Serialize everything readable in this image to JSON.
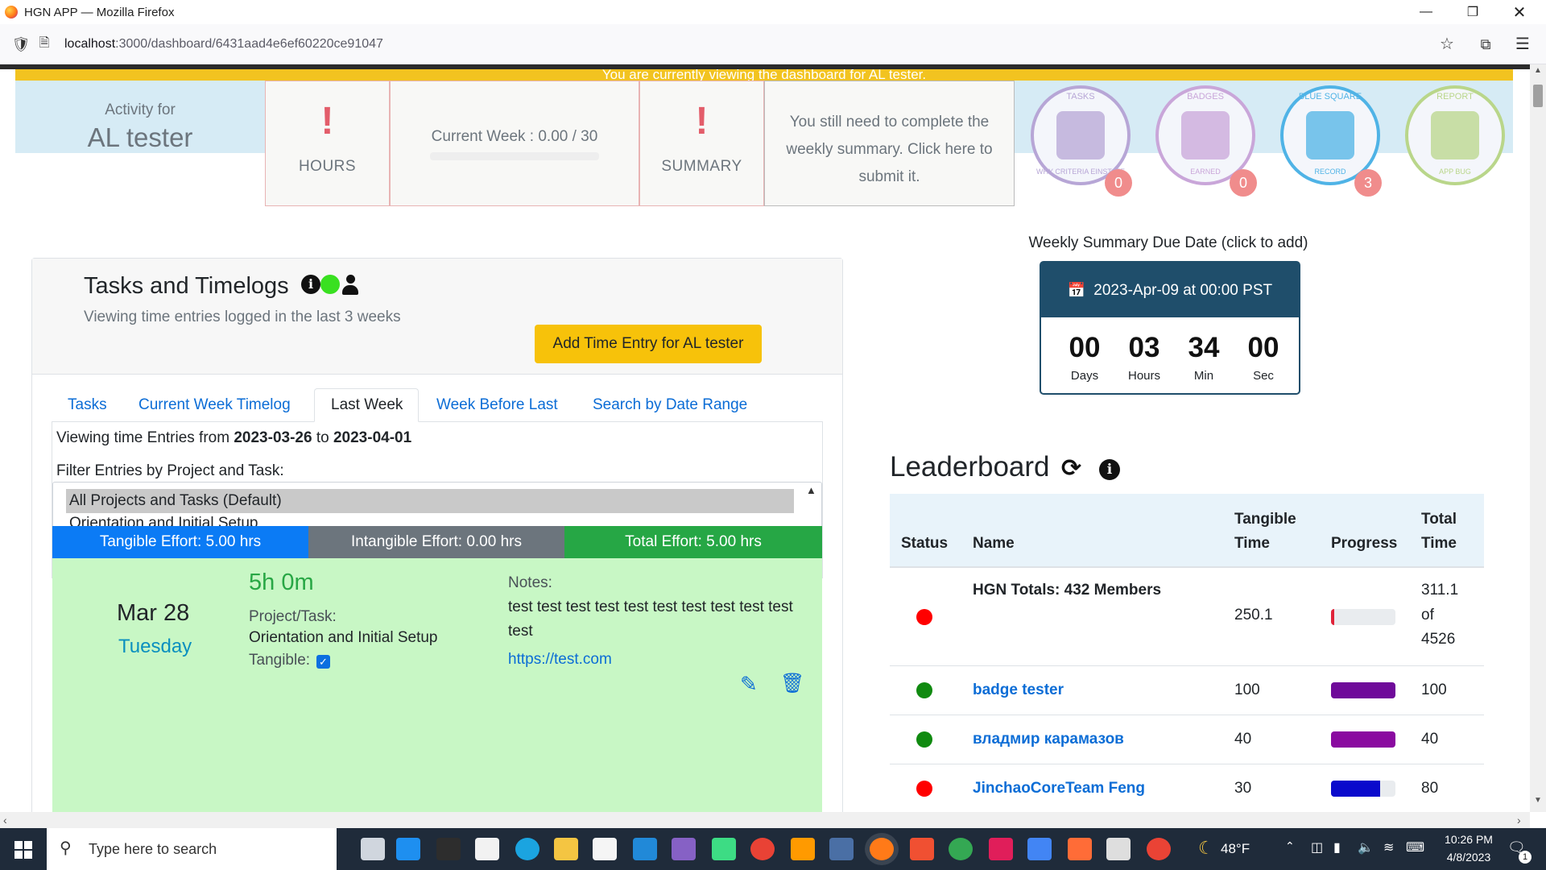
{
  "window": {
    "title": "HGN APP — Mozilla Firefox",
    "url_host": "localhost",
    "url_path": ":3000/dashboard/6431aad4e6ef60220ce91047"
  },
  "banner": {
    "notice": "You are currently viewing the dashboard for AL tester.",
    "activity_label": "Activity for",
    "activity_name": "AL tester",
    "hours_label": "HOURS",
    "current_week": "Current Week : 0.00 / 30",
    "summary_label": "SUMMARY",
    "summary_msg": "You still need to complete the weekly summary. Click here to submit it.",
    "badges": [
      {
        "name": "TASKS",
        "sub": "WHY CRITERIA EINSTATE",
        "count": "0",
        "color": "#b7a6d6"
      },
      {
        "name": "BADGES",
        "sub": "EARNED",
        "count": "0",
        "color": "#c9a6d9"
      },
      {
        "name": "BLUE SQUARE",
        "sub": "RECORD",
        "count": "3",
        "color": "#4fb3e6"
      },
      {
        "name": "REPORT",
        "sub": "APP BUG",
        "count": "",
        "color": "#b9d68a"
      }
    ]
  },
  "tasks": {
    "title": "Tasks and Timelogs",
    "subtitle": "Viewing time entries logged in the last 3 weeks",
    "add_button": "Add Time Entry for AL tester",
    "tabs": [
      "Tasks",
      "Current Week Timelog",
      "Last Week",
      "Week Before Last",
      "Search by Date Range"
    ],
    "viewing_prefix": "Viewing time Entries from",
    "date_from": "2023-03-26",
    "to_word": "to",
    "date_to": "2023-04-01",
    "filter_label": "Filter Entries by Project and Task:",
    "filter_options": [
      "All Projects and Tasks (Default)",
      "Orientation and Initial Setup"
    ],
    "tangible_effort": "Tangible Effort: 5.00 hrs",
    "intangible_effort": "Intangible Effort: 0.00 hrs",
    "total_effort": "Total Effort: 5.00 hrs",
    "entry": {
      "date": "Mar 28",
      "weekday": "Tuesday",
      "duration": "5h 0m",
      "project_label": "Project/Task:",
      "project": "Orientation and Initial Setup",
      "tangible_label": "Tangible:",
      "notes_label": "Notes:",
      "notes": "test test test test test test test test test test test",
      "link": "https://test.com"
    }
  },
  "due": {
    "label": "Weekly Summary Due Date (click to add)",
    "date": "2023-Apr-09 at 00:00 PST",
    "days": "00",
    "days_label": "Days",
    "hours": "03",
    "hours_label": "Hours",
    "min": "34",
    "min_label": "Min",
    "sec": "00",
    "sec_label": "Sec"
  },
  "leaderboard": {
    "title": "Leaderboard",
    "headers": {
      "status": "Status",
      "name": "Name",
      "tangible_1": "Tangible",
      "tangible_2": "Time",
      "progress": "Progress",
      "total_1": "Total",
      "total_2": "Time"
    },
    "totals": {
      "name": "HGN Totals: 432 Members",
      "tangible": "250.1",
      "total_1": "311.1",
      "total_2": "of",
      "total_3": "4526",
      "progress": 0.05,
      "status_color": "#ff0000",
      "bar_color": "#e0243a"
    },
    "rows": [
      {
        "name": "badge tester",
        "tangible": "100",
        "total": "100",
        "progress": 1.0,
        "status_color": "#108a10",
        "bar_color": "#6f0a9a"
      },
      {
        "name": "владмир карамазов",
        "tangible": "40",
        "total": "40",
        "progress": 1.0,
        "status_color": "#108a10",
        "bar_color": "#8a0aa0"
      },
      {
        "name": "JinchaoCoreTeam Feng",
        "tangible": "30",
        "total": "80",
        "progress": 0.76,
        "status_color": "#ff0000",
        "bar_color": "#0a0acc"
      }
    ]
  },
  "taskbar": {
    "search_placeholder": "Type here to search",
    "weather": "48°F",
    "time": "10:26 PM",
    "date": "4/8/2023",
    "notif_count": "1"
  }
}
